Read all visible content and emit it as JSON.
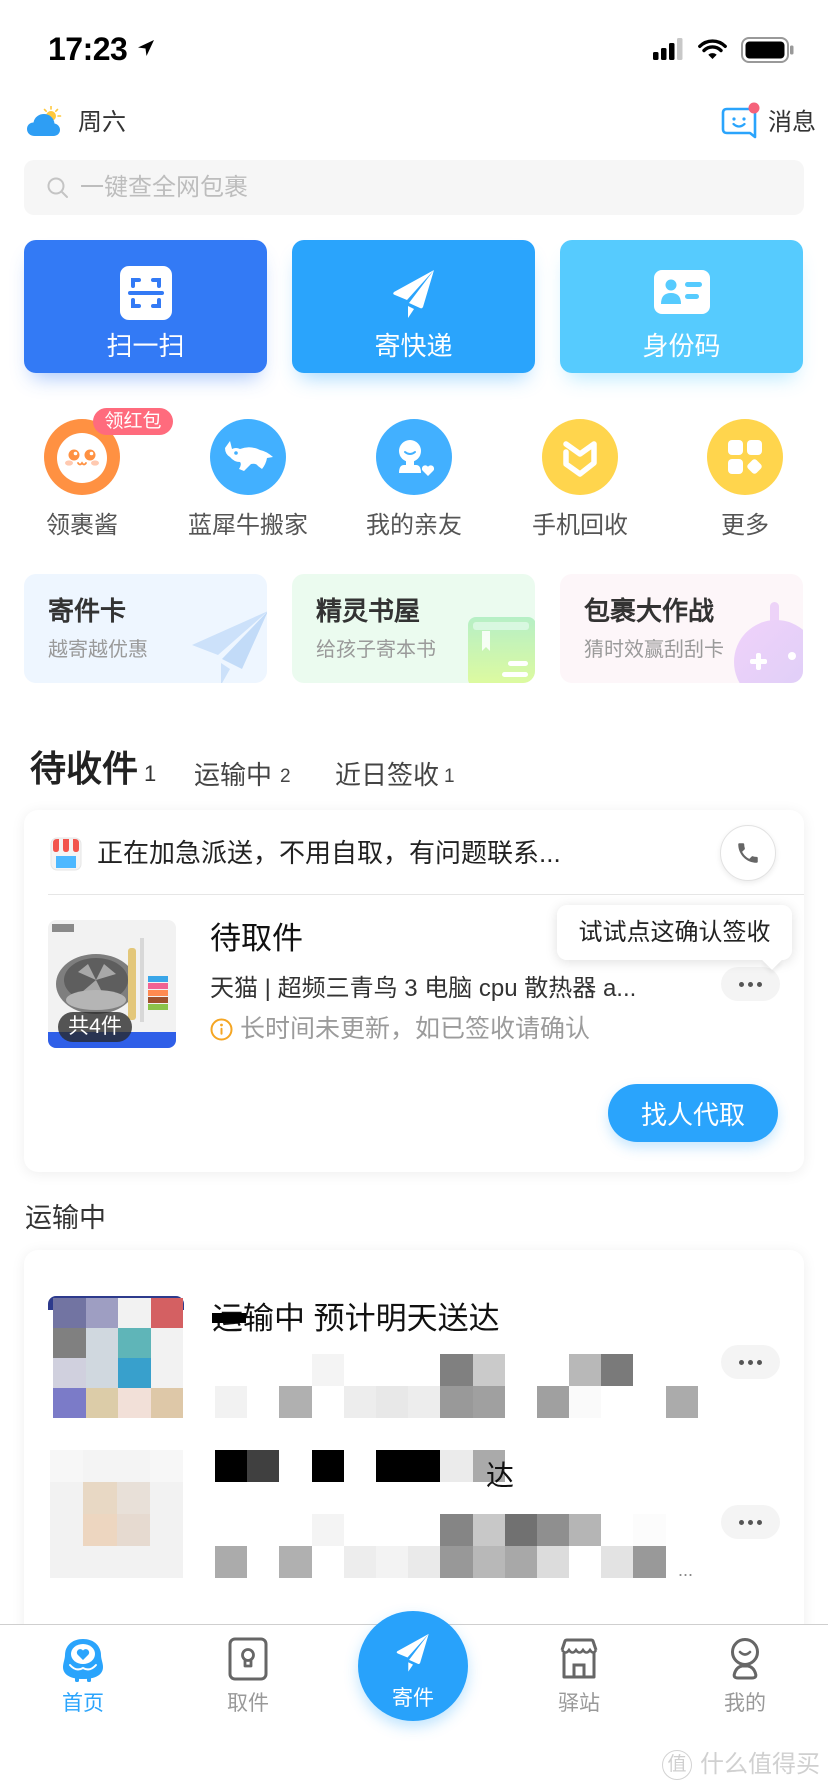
{
  "status_bar": {
    "time": "17:23",
    "icons": [
      "location-arrow-icon",
      "signal-icon",
      "wifi-icon",
      "battery-icon"
    ]
  },
  "header": {
    "weather_icon": "partly-cloudy-icon",
    "day": "周六",
    "message_icon": "message-smile-icon",
    "message_label": "消息",
    "message_has_badge": true
  },
  "search": {
    "placeholder": "一键查全网包裹",
    "value": ""
  },
  "quick_actions": [
    {
      "label": "扫一扫",
      "icon": "scan-icon",
      "color": "#337AF5"
    },
    {
      "label": "寄快递",
      "icon": "paper-plane-icon",
      "color": "#2AA4FC"
    },
    {
      "label": "身份码",
      "icon": "id-card-icon",
      "color": "#56CBFE"
    }
  ],
  "services": [
    {
      "label": "领裹酱",
      "badge": "领红包",
      "icon": "mascot-face-icon",
      "color": "#FF9142"
    },
    {
      "label": "蓝犀牛搬家",
      "icon": "rhino-icon",
      "color": "#42B0FF"
    },
    {
      "label": "我的亲友",
      "icon": "friend-icon",
      "color": "#42B0FF"
    },
    {
      "label": "手机回收",
      "icon": "recycle-heart-icon",
      "color": "#FFD54D"
    },
    {
      "label": "更多",
      "icon": "more-apps-icon",
      "color": "#FFD54D"
    }
  ],
  "promos": [
    {
      "title": "寄件卡",
      "subtitle": "越寄越优惠",
      "bg": "#EEF6FF"
    },
    {
      "title": "精灵书屋",
      "subtitle": "给孩子寄本书",
      "bg": "#EBFBEF"
    },
    {
      "title": "包裹大作战",
      "subtitle": "猜时效赢刮刮卡",
      "bg": "#FDF6F9"
    }
  ],
  "package_tabs": [
    {
      "label": "待收件",
      "count": "1",
      "active": true
    },
    {
      "label": "运输中",
      "count": "2",
      "active": false
    },
    {
      "label": "近日签收",
      "count": "1",
      "active": false
    }
  ],
  "pending_card": {
    "notice": "正在加急派送，不用自取，有问题联系...",
    "status": "待取件",
    "product": "天猫 | 超频三青鸟 3 电脑 cpu 散热器 a...",
    "warning": "长时间未更新，如已签收请确认",
    "item_count": "共4件",
    "tooltip": "试试点这确认签收",
    "action": "找人代取"
  },
  "transit_section": {
    "title": "运输中",
    "items": [
      {
        "status": "运输中 预计明天送达",
        "redacted": true,
        "mosaic_image": [
          [
            "#7274A2",
            "#9E9EC2",
            "#F2F2F2",
            "#D46062"
          ],
          [
            "#808080",
            "#D0D8DF",
            "#5FB5B8",
            "#F2F2F2"
          ],
          [
            "#D0D0DE",
            "#D0D8DF",
            "#38A0CC",
            "#F2F2F2"
          ],
          [
            "#7B7BC8",
            "#DCCCA8",
            "#F2E0D8",
            "#DEC8A8"
          ]
        ],
        "mosaic_desc": [
          [
            "",
            "",
            "",
            "#F4F4F4",
            "",
            "",
            "",
            "#808080",
            "#CACACA",
            "",
            "",
            "#B8B8B8",
            "#7A7A7A",
            "",
            "",
            ""
          ],
          [
            "#F2F2F2",
            "",
            "#B0B0B0",
            "",
            "#EDEDED",
            "#E8E8E8",
            "#EDEDED",
            "#999999",
            "#A0A0A0",
            "",
            "#A0A0A0",
            "#FAFAFA",
            "",
            "",
            "#ABABAB",
            ""
          ]
        ]
      },
      {
        "status_tail": "达",
        "redacted": true,
        "mosaic_title": [
          [
            "#000000",
            "#404040",
            "",
            "#000000",
            "",
            "#000000",
            "#000000",
            "#EBEBEB",
            "#AAAAAA"
          ]
        ],
        "mosaic_image": [
          [
            "#F7F7F7",
            "#F4F4F4",
            "#F4F4F4",
            "#F7F7F7"
          ],
          [
            "#F2F2F2",
            "#E8D8C4",
            "#E8E0D8",
            "#F2F2F2"
          ],
          [
            "#F2F2F2",
            "#EDD6C0",
            "#E6DAD0",
            "#F2F2F2"
          ],
          [
            "#F2F2F2",
            "#F2F2F2",
            "#F2F2F2",
            "#F2F2F2"
          ]
        ],
        "mosaic_desc": [
          [
            "",
            "",
            "",
            "#F4F4F4",
            "",
            "",
            "",
            "#858585",
            "#C8C8C8",
            "#717171",
            "#8F8F8F",
            "#B5B5B5",
            "",
            "#FCFCFC"
          ],
          [
            "#ABABAB",
            "",
            "#B0B0B0",
            "",
            "#EDEDED",
            "#F3F3F3",
            "#EAEAEA",
            "#989898",
            "#B8B8B8",
            "#A8A8A8",
            "#DCDCDC",
            "",
            "#E3E3E3",
            "#999999"
          ]
        ],
        "desc_tail": "..."
      }
    ]
  },
  "bottom_nav": [
    {
      "label": "首页",
      "icon": "home-mascot-icon",
      "active": true
    },
    {
      "label": "取件",
      "icon": "locker-icon",
      "active": false
    },
    {
      "label": "寄件",
      "icon": "paper-plane-icon",
      "primary": true
    },
    {
      "label": "驿站",
      "icon": "storefront-icon",
      "active": false
    },
    {
      "label": "我的",
      "icon": "profile-icon",
      "active": false
    }
  ],
  "watermark": {
    "badge": "值",
    "text": "什么值得买"
  },
  "colors": {
    "primary": "#2AA4FC",
    "scan_blue": "#337AF5",
    "text": "#222222",
    "muted": "#999999",
    "warning": "#F5A623",
    "badge_red": "#FF6B7D"
  }
}
